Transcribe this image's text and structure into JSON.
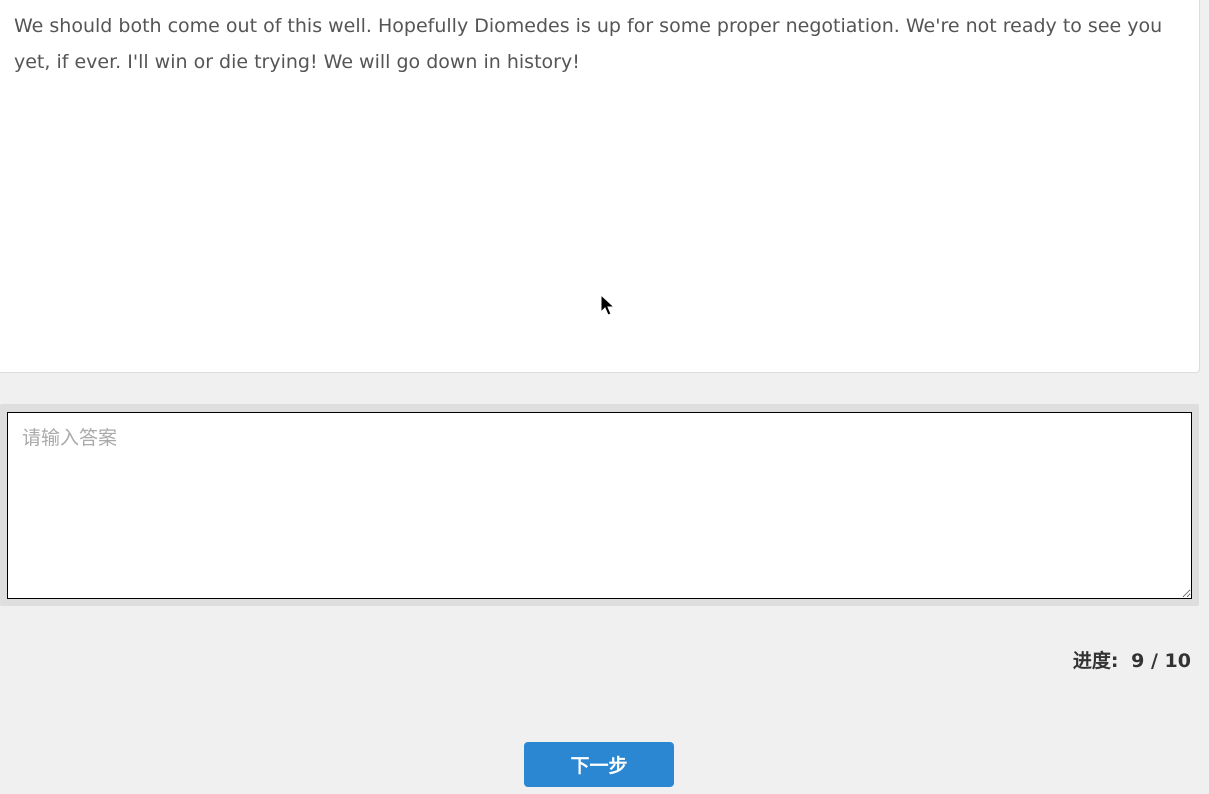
{
  "prompt": {
    "text": "We should both come out of this well. Hopefully Diomedes is up for some proper negotiation. We're not ready to see you yet, if ever. I'll win or die trying! We will go down in history!"
  },
  "answer": {
    "value": "",
    "placeholder": "请输入答案"
  },
  "progress": {
    "label": "进度:",
    "value": "9 / 10"
  },
  "actions": {
    "next_label": "下一步"
  },
  "colors": {
    "accent": "#2b87d1",
    "background": "#f0f0f0",
    "panel": "#ffffff"
  },
  "icons": {
    "cursor": "mouse-pointer-icon"
  }
}
